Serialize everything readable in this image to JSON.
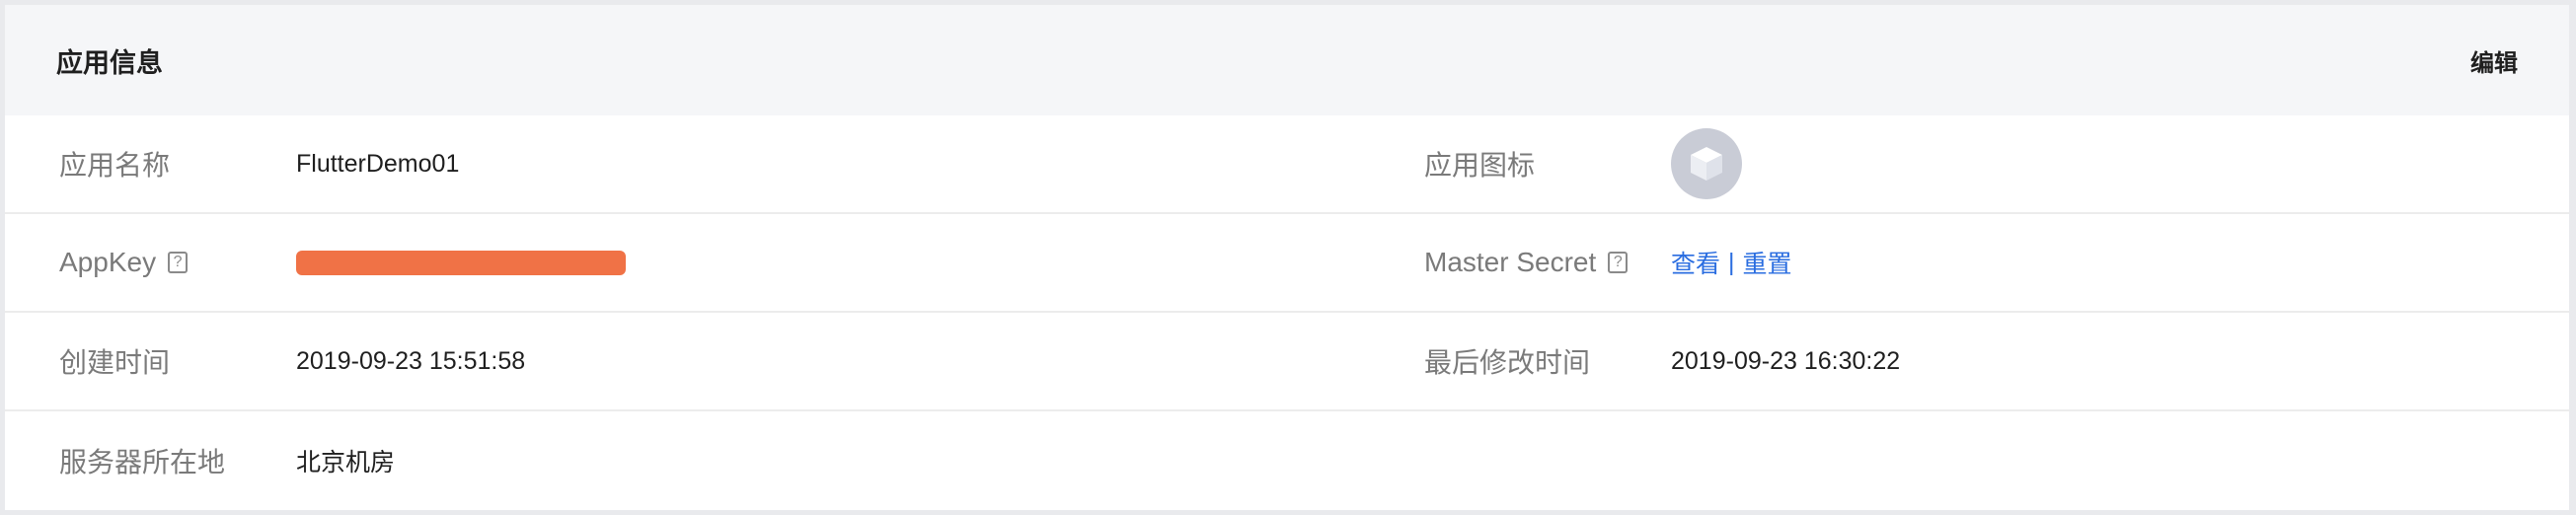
{
  "header": {
    "title": "应用信息",
    "edit_label": "编辑"
  },
  "rows": {
    "app_name": {
      "label": "应用名称",
      "value": "FlutterDemo01"
    },
    "app_icon": {
      "label": "应用图标",
      "icon": "cube-icon"
    },
    "app_key": {
      "label": "AppKey",
      "help": "?",
      "masked_color": "#f07246"
    },
    "master_secret": {
      "label": "Master Secret",
      "help": "?",
      "view_label": "查看",
      "separator": "|",
      "reset_label": "重置"
    },
    "created": {
      "label": "创建时间",
      "value": "2019-09-23 15:51:58"
    },
    "modified": {
      "label": "最后修改时间",
      "value": "2019-09-23 16:30:22"
    },
    "server_location": {
      "label": "服务器所在地",
      "value": "北京机房"
    }
  },
  "colors": {
    "link": "#2a6de0",
    "header_bg": "#f5f6f8",
    "label": "#7a7a7a"
  }
}
